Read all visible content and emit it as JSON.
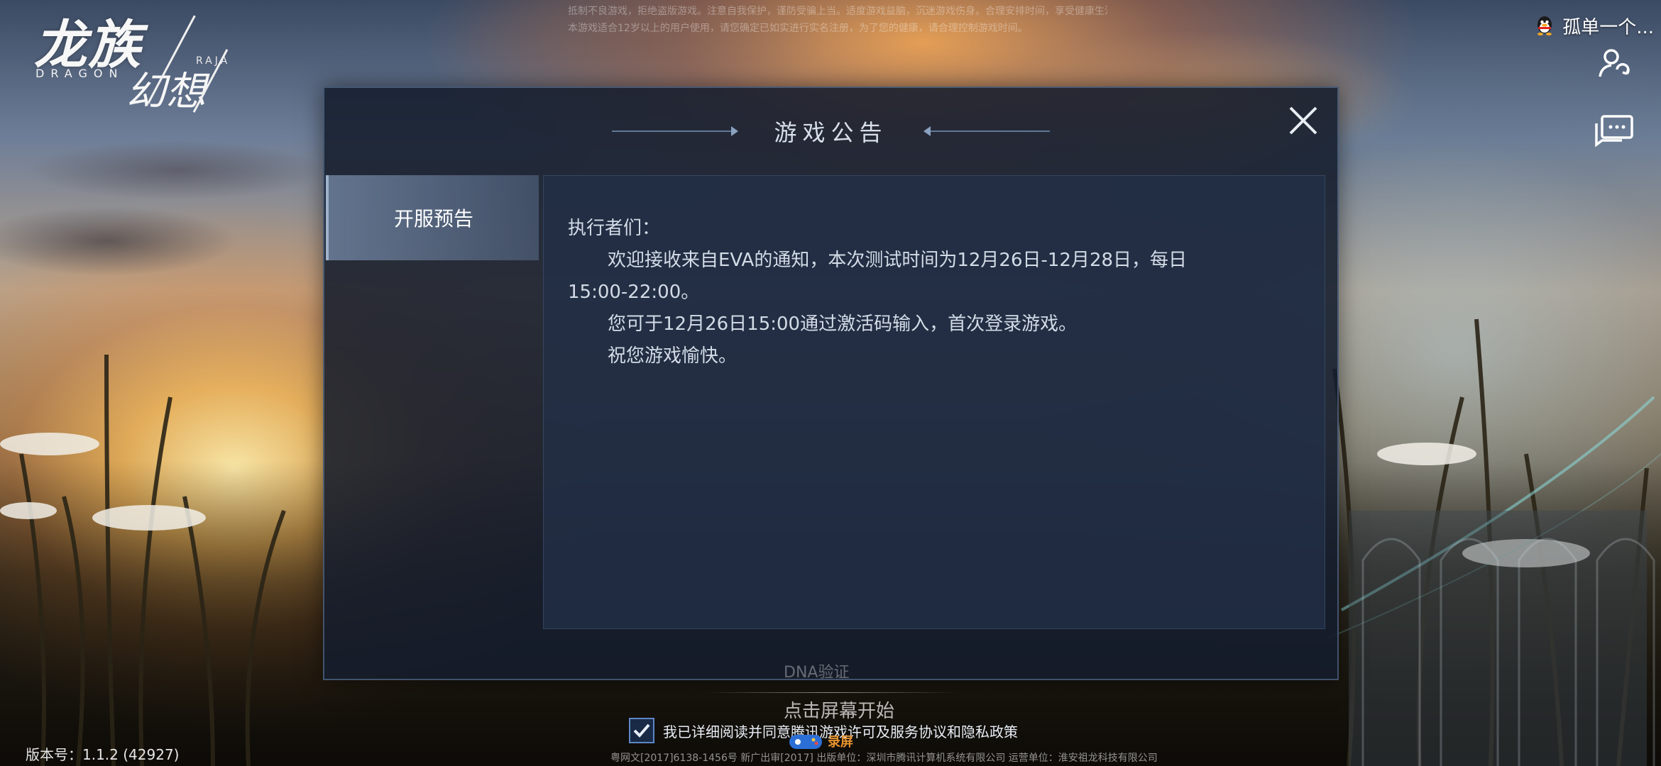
{
  "logo": {
    "title_cn_1": "龙族",
    "title_en": "DRAGON",
    "title_cn_2": "幻想",
    "title_en_2": "RAJA"
  },
  "top_notice": {
    "line1": "抵制不良游戏，拒绝盗版游戏。注意自我保护，谨防受骗上当。适度游戏益脑，沉迷游戏伤身。合理安排时间，享受健康生活。",
    "line2": "本游戏适合12岁以上的用户使用，请您确定已如实进行实名注册，为了您的健康，请合理控制游戏时间。"
  },
  "user": {
    "name": "孤单一个...",
    "icon": "qq-penguin-icon"
  },
  "side_buttons": [
    {
      "icon": "switch-account-icon"
    },
    {
      "icon": "chat-message-icon"
    }
  ],
  "modal": {
    "title": "游戏公告",
    "close_icon": "close-icon",
    "tabs": [
      {
        "label": "开服预告",
        "selected": true
      }
    ],
    "content": {
      "greeting": "执行者们：",
      "line1": "欢迎接收来自EVA的通知，本次测试时间为12月26日-12月28日，每日",
      "line2": "15:00-22:00。",
      "line3": "您可于12月26日15:00通过激活码输入，首次登录游戏。",
      "line4": "祝您游戏愉快。"
    }
  },
  "bottom": {
    "faded_label": "DNA验证",
    "tap_to_start": "点击屏幕开始",
    "agree_checked": true,
    "agree_text": "我已详细阅读并同意腾讯游戏许可及服务协议和隐私政策",
    "license_text": "粤网文[2017]6138-1456号  新广出审[2017]  出版单位：深圳市腾讯计算机系统有限公司  运营单位：淮安祖龙科技有限公司",
    "version": "版本号：1.1.2 (42927)",
    "watermark": "录屏"
  },
  "colors": {
    "modal_bg": "#141d2c",
    "panel_bg": "#22304a",
    "tab_bg": "#788caa",
    "checkbox_accent": "#5d86c5",
    "watermark": "#e79230"
  }
}
